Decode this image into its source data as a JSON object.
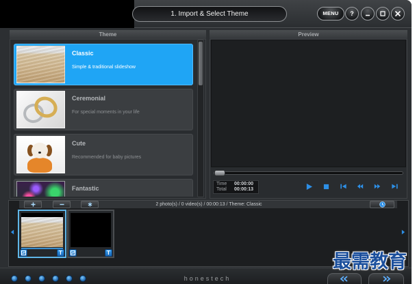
{
  "app": {
    "title": "1. Import & Select Theme",
    "menu_label": "MENU",
    "help_label": "?",
    "window_controls": [
      "minimize-icon",
      "maximize-icon",
      "close-icon"
    ]
  },
  "theme_panel": {
    "header": "Theme",
    "items": [
      {
        "name": "Classic",
        "description": "Simple & traditional slideshow",
        "selected": true
      },
      {
        "name": "Ceremonial",
        "description": "For special moments in your life",
        "selected": false
      },
      {
        "name": "Cute",
        "description": "Recommended for baby pictures",
        "selected": false
      },
      {
        "name": "Fantastic",
        "selected": false
      }
    ]
  },
  "preview_panel": {
    "header": "Preview",
    "seek_position": 0,
    "time_label": "Time",
    "time_value": "00:00:00",
    "total_label": "Total",
    "total_value": "00:00:13",
    "controls": [
      "play-icon",
      "stop-icon",
      "skip-to-start-icon",
      "rewind-icon",
      "fast-forward-icon",
      "skip-to-end-icon"
    ]
  },
  "storyboard": {
    "toolbar": [
      "plus-icon",
      "minus-icon",
      "asterisk-icon"
    ],
    "summary": "2 photo(s) / 0 video(s) / 00:00:13 / Theme: Classic",
    "options_icon": "clock-icon",
    "scroll_icons": [
      "arrow-left-icon",
      "arrow-right-icon"
    ],
    "slots": [
      {
        "selected": true,
        "edit_icon": "photo-edit-icon",
        "text_badge": "T"
      },
      {
        "selected": false,
        "edit_icon": "photo-edit-icon",
        "text_badge": "T"
      }
    ]
  },
  "footer": {
    "brand": "honestech",
    "prev_icon": "double-chevron-left-icon",
    "next_icon": "double-chevron-right-icon"
  },
  "watermark": {
    "text": "最需教育"
  },
  "colors": {
    "accent": "#1fa5f5",
    "icon_blue": "#2d8fe6",
    "window_bg": "#2c2f32",
    "item_bg": "#3b3e41",
    "preview_bg": "#1d1f21"
  }
}
